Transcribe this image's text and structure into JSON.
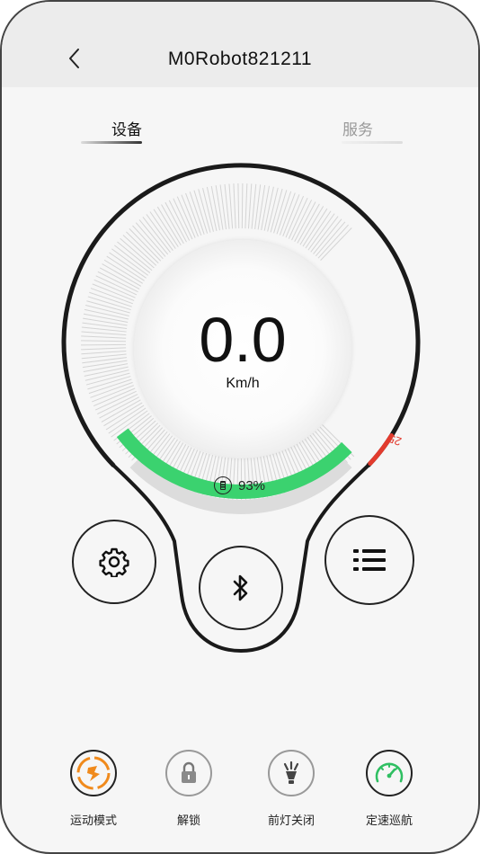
{
  "header": {
    "title": "M0Robot821211",
    "back_icon": "chevron-left-icon"
  },
  "tabs": [
    {
      "label": "设备",
      "active": true
    },
    {
      "label": "服务",
      "active": false
    }
  ],
  "speedometer": {
    "speed": "0.0",
    "unit": "Km/h",
    "speed_limit": "25",
    "speed_fraction": 0,
    "battery_percent_text": "93%",
    "battery_fraction": 0.93,
    "colors": {
      "battery": "#3bd26f",
      "limit": "#e23b2e",
      "ring": "#1a1a1a",
      "ticks": "#d4d4d4"
    }
  },
  "controls": [
    {
      "name": "settings",
      "icon": "gear-icon"
    },
    {
      "name": "bluetooth",
      "icon": "bluetooth-icon"
    },
    {
      "name": "menu",
      "icon": "list-icon"
    }
  ],
  "quick_actions": [
    {
      "label": "运动模式",
      "icon": "sport-mode-icon",
      "color": "#f08a1c"
    },
    {
      "label": "解锁",
      "icon": "padlock-icon",
      "color": "#8a8a8a"
    },
    {
      "label": "前灯关闭",
      "icon": "headlight-icon",
      "color": "#555555"
    },
    {
      "label": "定速巡航",
      "icon": "cruise-gauge-icon",
      "color": "#2fbf62"
    }
  ]
}
